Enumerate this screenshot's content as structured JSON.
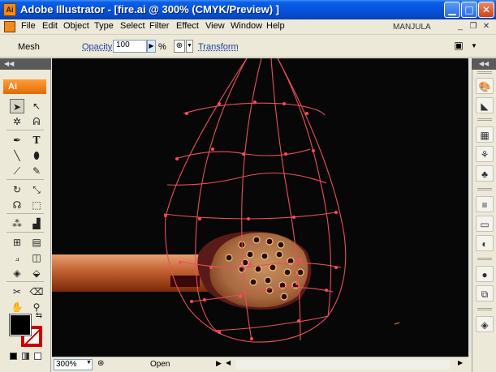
{
  "window": {
    "title": "Adobe Illustrator - [fire.ai @ 300% (CMYK/Preview) ]",
    "app_icon_label": "Ai"
  },
  "menubar": {
    "items": [
      "File",
      "Edit",
      "Object",
      "Type",
      "Select",
      "Filter",
      "Effect",
      "View",
      "Window",
      "Help"
    ],
    "user": "MANJULA"
  },
  "controlbar": {
    "tool_name": "Mesh",
    "opacity_label": "Opacity:",
    "opacity_value": "100",
    "percent": "%",
    "transform_label": "Transform"
  },
  "tools_panel": {
    "logo": "Ai",
    "tools": [
      "selection-tool",
      "direct-selection-tool",
      "magic-wand-tool",
      "lasso-tool",
      "pen-tool",
      "type-tool",
      "line-tool",
      "ellipse-tool",
      "paintbrush-tool",
      "pencil-tool",
      "rotate-tool",
      "scale-tool",
      "warp-tool",
      "free-transform-tool",
      "symbol-sprayer-tool",
      "column-graph-tool",
      "mesh-tool",
      "gradient-tool",
      "eyedropper-tool",
      "blend-tool",
      "live-paint-bucket-tool",
      "live-paint-selection-tool",
      "slice-tool",
      "eraser-tool",
      "hand-tool",
      "zoom-tool"
    ],
    "active_tool": "direct-selection-tool",
    "fill_color": "#000000",
    "stroke_color": "#cc0000"
  },
  "canvas": {
    "background": "#070707",
    "mesh_color": "#e8505a"
  },
  "statusbar": {
    "zoom": "300%",
    "status": "Open"
  },
  "dock": {
    "icons": [
      "brushes-icon",
      "gradient-panel-icon",
      "swatches-icon",
      "symbols-icon",
      "graphic-styles-icon",
      "stroke-icon",
      "gradient-icon",
      "transparency-icon",
      "appearance-icon",
      "color-guide-icon",
      "layers-icon"
    ]
  }
}
